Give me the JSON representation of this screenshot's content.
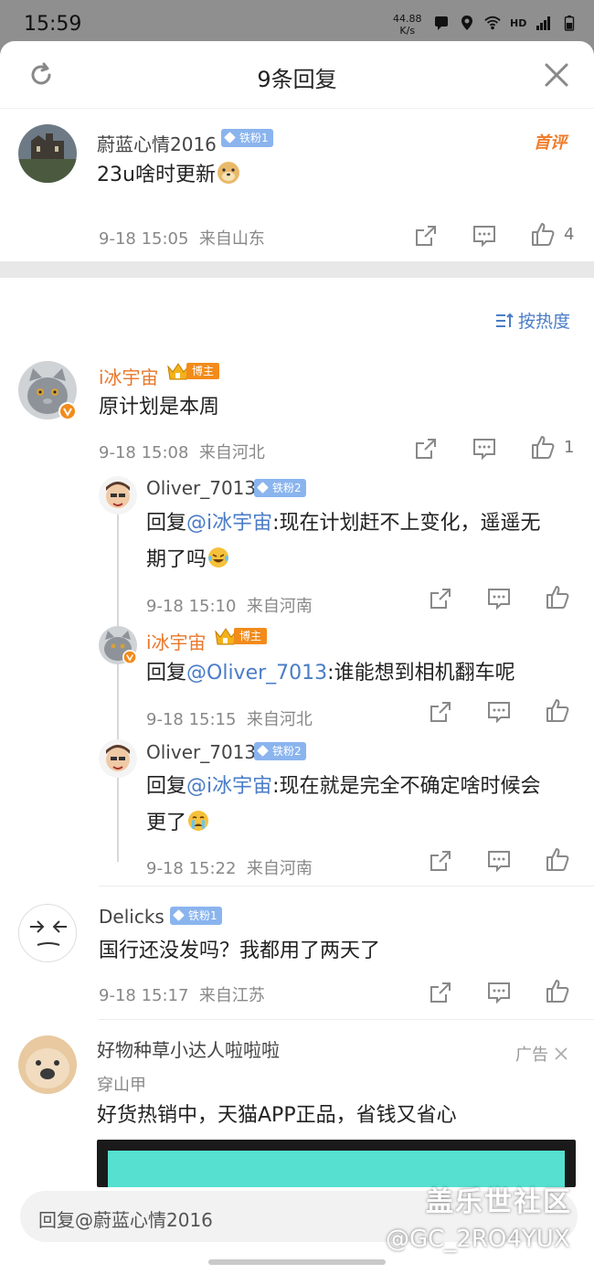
{
  "status_bar": {
    "time": "15:59",
    "speed_value": "44.88",
    "speed_unit": "K/s",
    "hd": "HD"
  },
  "header": {
    "title": "9条回复"
  },
  "root_comment": {
    "user": "蔚蓝心情2016",
    "badge": "铁粉1",
    "tag": "首评",
    "content": "23u啥时更新",
    "emoji": "doge",
    "time": "9-18 15:05",
    "location": "来自山东",
    "likes": "4"
  },
  "sort": {
    "label": "按热度"
  },
  "comments": [
    {
      "user": "i冰宇宙",
      "badge": "博主",
      "content": "原计划是本周",
      "time": "9-18 15:08",
      "location": "来自河北",
      "likes": "1"
    },
    {
      "user": "Delicks",
      "badge": "铁粉1",
      "content": "国行还没发吗？我都用了两天了",
      "time": "9-18 15:17",
      "location": "来自江苏"
    }
  ],
  "replies": [
    {
      "user": "Oliver_7013",
      "badge": "铁粉2",
      "prefix": "回复",
      "mention": "@i冰宇宙",
      "line1": ":现在计划赶不上变化，遥遥无",
      "line2": "期了吗",
      "time": "9-18 15:10",
      "location": "来自河南"
    },
    {
      "user": "i冰宇宙",
      "badge": "博主",
      "prefix": "回复",
      "mention": "@Oliver_7013",
      "line1": ":谁能想到相机翻车呢",
      "time": "9-18 15:15",
      "location": "来自河北"
    },
    {
      "user": "Oliver_7013",
      "badge": "铁粉2",
      "prefix": "回复",
      "mention": "@i冰宇宙",
      "line1": ":现在就是完全不确定啥时候会",
      "line2": "更了",
      "time": "9-18 15:22",
      "location": "来自河南"
    }
  ],
  "ad": {
    "user": "好物种草小达人啦啦啦",
    "brand": "穿山甲",
    "label": "广告",
    "content": "好货热销中，天猫APP正品，省钱又省心"
  },
  "reply_bar": {
    "placeholder": "回复@蔚蓝心情2016"
  },
  "watermark": {
    "line1": "盖乐世社区",
    "line2": "@GC_2RO4YUX"
  },
  "colors": {
    "accent_blue": "#4a7cc7",
    "host_orange": "#e8772a",
    "fan_badge": "#8ab4ee"
  }
}
